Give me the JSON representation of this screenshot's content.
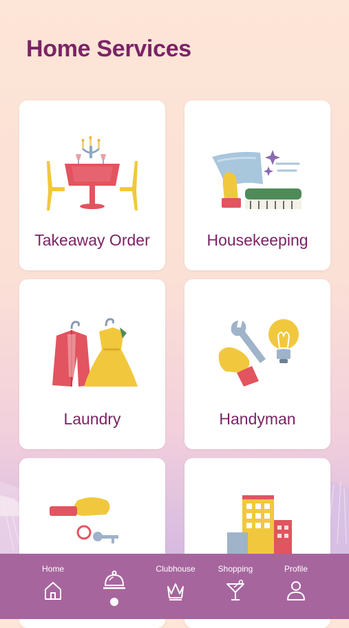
{
  "header": {
    "title": "Home Services"
  },
  "services": [
    {
      "label": "Takeaway Order",
      "icon": "dining-table-icon"
    },
    {
      "label": "Housekeeping",
      "icon": "cleaning-icon"
    },
    {
      "label": "Laundry",
      "icon": "clothes-hanger-icon"
    },
    {
      "label": "Handyman",
      "icon": "wrench-bulb-icon"
    },
    {
      "label": "",
      "icon": "key-handover-icon"
    },
    {
      "label": "",
      "icon": "buildings-icon"
    }
  ],
  "tabbar": {
    "items": [
      {
        "label": "Home",
        "icon": "home-icon"
      },
      {
        "label": "",
        "icon": "service-bell-icon",
        "active": true
      },
      {
        "label": "Clubhouse",
        "icon": "crown-icon"
      },
      {
        "label": "Shopping",
        "icon": "cocktail-icon"
      },
      {
        "label": "Profile",
        "icon": "person-icon"
      }
    ]
  },
  "colors": {
    "accent": "#7b2366",
    "tabbar": "#a7659e",
    "card": "#ffffff"
  }
}
